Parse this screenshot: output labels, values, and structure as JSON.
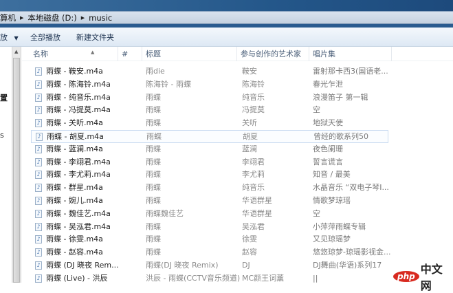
{
  "breadcrumb": [
    "算机",
    "本地磁盘 (D:)",
    "music"
  ],
  "toolbar": {
    "organize": "放",
    "play_all": "全部播放",
    "new_folder": "新建文件夹"
  },
  "nav": {
    "item1": "置",
    "item2": "s"
  },
  "columns": {
    "name": "名称",
    "number": "#",
    "title": "标题",
    "artist": "参与创作的艺术家",
    "album": "唱片集"
  },
  "rows": [
    {
      "name": "雨蝶 - 鞍安.m4a",
      "title": "雨die",
      "artist": "鞍安",
      "album": "雷射那卡西3(国语老..."
    },
    {
      "name": "雨蝶 - 陈海铃.m4a",
      "title": "陈海铃 - 雨蝶",
      "artist": "陈海铃",
      "album": "春光乍泄"
    },
    {
      "name": "雨蝶 - 纯音乐.m4a",
      "title": "雨蝶",
      "artist": "纯音乐",
      "album": "浪漫笛子 第一辑"
    },
    {
      "name": "雨蝶 - 冯提莫.m4a",
      "title": "雨蝶",
      "artist": "冯提莫",
      "album": "空"
    },
    {
      "name": "雨蝶 - 关听.m4a",
      "title": "雨蝶",
      "artist": "关听",
      "album": "地狱天使"
    },
    {
      "name": "雨蝶 - 胡夏.m4a",
      "title": "雨蝶",
      "artist": "胡夏",
      "album": "曾经的歌系列50"
    },
    {
      "name": "雨蝶 - 蓝澜.m4a",
      "title": "雨蝶",
      "artist": "蓝澜",
      "album": "夜色阑珊"
    },
    {
      "name": "雨蝶 - 李翊君.m4a",
      "title": "雨蝶",
      "artist": "李翊君",
      "album": "誓言谎言"
    },
    {
      "name": "雨蝶 - 李尤莉.m4a",
      "title": "雨蝶",
      "artist": "李尤莉",
      "album": "知音 / 最美"
    },
    {
      "name": "雨蝶 - 群星.m4a",
      "title": "雨蝶",
      "artist": "纯音乐",
      "album": "水晶音乐 “双电子琴I..."
    },
    {
      "name": "雨蝶 - 婉儿.m4a",
      "title": "雨蝶",
      "artist": "华语群星",
      "album": "情歌梦琼瑶"
    },
    {
      "name": "雨蝶 - 魏佳艺.m4a",
      "title": "雨蝶魏佳艺",
      "artist": "华语群星",
      "album": "空"
    },
    {
      "name": "雨蝶 - 吴泓君.m4a",
      "title": "雨蝶",
      "artist": "吴泓君",
      "album": "小萍萍雨蝶专辑"
    },
    {
      "name": "雨蝶 - 徐雯.m4a",
      "title": "雨蝶",
      "artist": "徐雯",
      "album": "又见琼瑶梦"
    },
    {
      "name": "雨蝶 - 赵容.m4a",
      "title": "雨蝶",
      "artist": "赵容",
      "album": "悠悠琼梦-琼瑶影视金..."
    },
    {
      "name": "雨蝶 (DJ 晓夜 Rem...",
      "title": "雨蝶(DJ 晓夜 Remix)",
      "artist": "DJ",
      "album": "DJ舞曲(华语)系列17"
    },
    {
      "name": "雨蝶 (Live) - 洪辰",
      "title": "洪辰 - 雨蝶(CCTV音乐频道)",
      "artist": "MC颜王词薰",
      "album": "||"
    }
  ],
  "selected_index": 5,
  "watermark": {
    "php": "php",
    "cn": "中文网"
  }
}
